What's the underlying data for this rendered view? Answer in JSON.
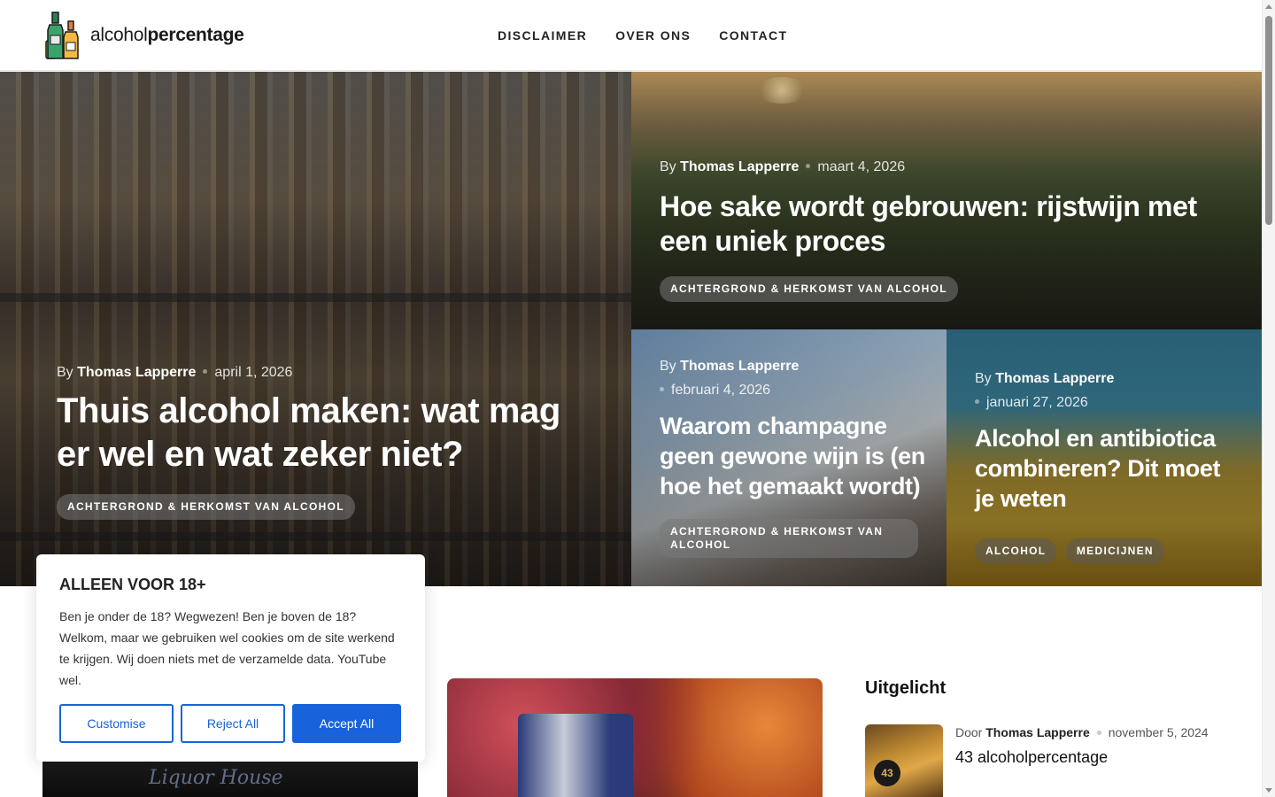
{
  "site": {
    "logo_light": "alcohol",
    "logo_bold": "percentage"
  },
  "nav": {
    "items": [
      {
        "label": "DISCLAIMER"
      },
      {
        "label": "OVER ONS"
      },
      {
        "label": "CONTACT"
      }
    ]
  },
  "hero": {
    "posts": [
      {
        "by": "By",
        "author": "Thomas Lapperre",
        "date": "april 1, 2026",
        "title": "Thuis alcohol maken: wat mag er wel en wat zeker niet?",
        "tags": [
          "ACHTERGROND & HERKOMST VAN ALCOHOL"
        ]
      },
      {
        "by": "By",
        "author": "Thomas Lapperre",
        "date": "maart 4, 2026",
        "title": "Hoe sake wordt gebrouwen: rijstwijn met een uniek proces",
        "tags": [
          "ACHTERGROND & HERKOMST VAN ALCOHOL"
        ]
      },
      {
        "by": "By",
        "author": "Thomas Lapperre",
        "date": "februari 4, 2026",
        "title": "Waarom champagne geen gewone wijn is (en hoe het gemaakt wordt)",
        "tags": [
          "ACHTERGROND & HERKOMST VAN ALCOHOL"
        ]
      },
      {
        "by": "By",
        "author": "Thomas Lapperre",
        "date": "januari 27, 2026",
        "title": "Alcohol en antibiotica combineren? Dit moet je weten",
        "tags": [
          "ALCOHOL",
          "MEDICIJNEN"
        ]
      }
    ]
  },
  "sidebar": {
    "title": "Uitgelicht",
    "featured": {
      "by": "Door",
      "author": "Thomas Lapperre",
      "date": "november 5, 2024",
      "title": "43 alcoholpercentage",
      "thumb_label": "43"
    }
  },
  "cookie": {
    "title": "ALLEEN VOOR 18+",
    "text": "Ben je onder de 18? Wegwezen! Ben je boven de 18? Welkom, maar we gebruiken wel cookies om de site werkend te krijgen. Wij doen niets met de verzamelde data. YouTube wel.",
    "customise": "Customise",
    "reject": "Reject All",
    "accept": "Accept All"
  },
  "lower": {
    "neon_text": "Liquor House"
  },
  "colors": {
    "accent": "#1863dc"
  }
}
